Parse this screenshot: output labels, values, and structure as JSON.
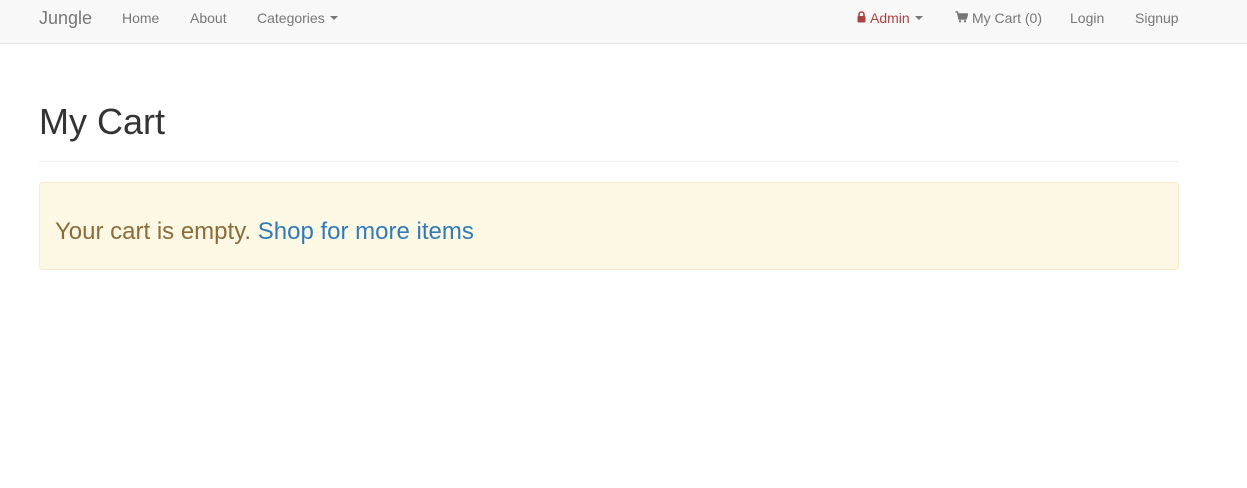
{
  "navbar": {
    "brand": "Jungle",
    "left_items": [
      {
        "label": "Home"
      },
      {
        "label": "About"
      },
      {
        "label": "Categories"
      }
    ],
    "right_items": {
      "admin": "Admin",
      "cart": "My Cart (0)",
      "login": "Login",
      "signup": "Signup"
    }
  },
  "main": {
    "title": "My Cart",
    "alert": {
      "message": "Your cart is empty.",
      "link": "Shop for more items"
    }
  },
  "colors": {
    "admin_text": "#a94442",
    "alert_bg": "#fcf8e3",
    "alert_text": "#8a6d3b",
    "link": "#337ab7"
  },
  "icons": {
    "admin": "lock-icon",
    "cart": "shopping-cart-icon",
    "dropdown": "caret-down-icon"
  }
}
